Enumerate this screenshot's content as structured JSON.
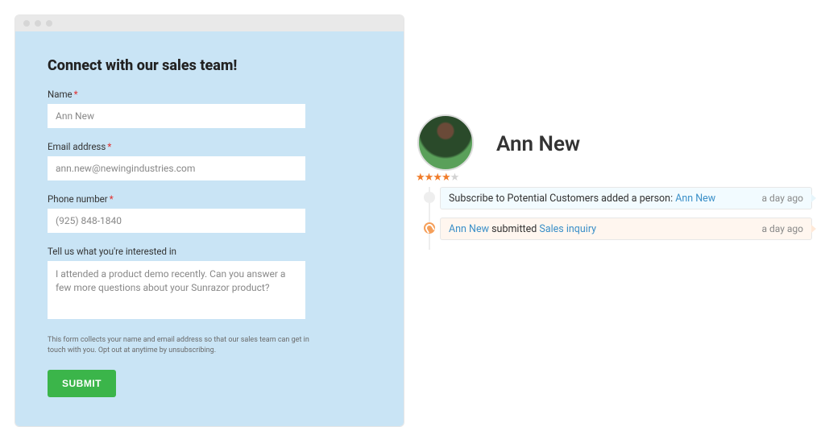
{
  "form": {
    "title": "Connect with our sales team!",
    "fields": {
      "name": {
        "label": "Name",
        "required": "*",
        "value": "Ann New"
      },
      "email": {
        "label": "Email address",
        "required": "*",
        "value": "ann.new@newingindustries.com"
      },
      "phone": {
        "label": "Phone number",
        "required": "*",
        "value": "(925) 848-1840"
      },
      "interest": {
        "label": "Tell us what you're interested in",
        "value": "I attended a product demo recently. Can you answer a few more questions about your Sunrazor product?"
      }
    },
    "disclaimer": "This form collects your name and email address so that our sales team can get in touch with you. Opt out at anytime by unsubscribing.",
    "submit_label": "SUBMIT"
  },
  "profile": {
    "name": "Ann New",
    "rating": {
      "filled": 4,
      "total": 5
    }
  },
  "timeline": [
    {
      "icon": "dot",
      "style": "blue",
      "text_prefix": "Subscribe to Potential Customers added a person: ",
      "link1": "Ann New",
      "text_mid": "",
      "link2": "",
      "time": "a day ago"
    },
    {
      "icon": "magnet",
      "style": "peach",
      "text_prefix": "",
      "link1": "Ann New",
      "text_mid": " submitted ",
      "link2": "Sales inquiry",
      "time": "a day ago"
    }
  ]
}
